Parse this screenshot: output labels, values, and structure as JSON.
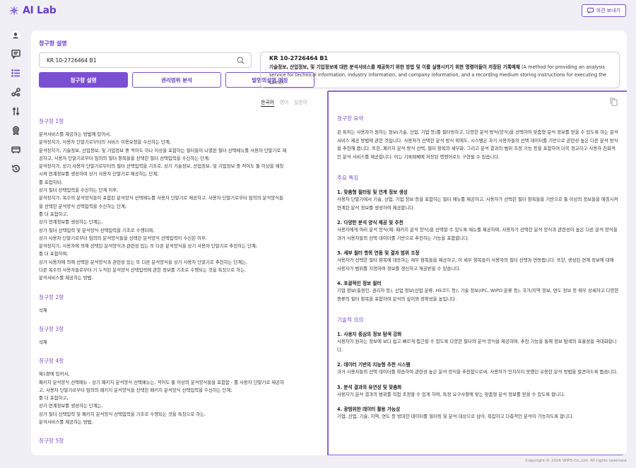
{
  "app": {
    "name": "AI Lab",
    "feedback_label": "의견 보내기",
    "footer": "Copyright © 2026 WIPS Co.,Ltd. All rights reserved."
  },
  "sidebar": {
    "icons": [
      "user-icon",
      "chat-icon",
      "list-icon",
      "network-icon",
      "swap-icon",
      "award-icon",
      "card-icon",
      "history-icon"
    ],
    "active": 2
  },
  "page": {
    "section_title": "청구항 설명",
    "search_value": "KR 10-2726464 B1"
  },
  "tabs": {
    "claim_desc": "청구항 설명",
    "rights_analysis": "권리범위 분석",
    "invention_mapping": "발명의설명 매핑"
  },
  "info": {
    "id": "KR 10-2726464 B1",
    "title_ko": "기술정보, 산업정보, 및 기업정보에 대한 분석서비스를 제공하기 위한 방법 및 이를 실행시키기 위한 명령어들이 저장된 기록매체",
    "title_en": " (A method for providing an analysis service for technical information, industry information, and company information, and a recording medium storing instructions for executing the same)"
  },
  "lang": {
    "ko": "한국어",
    "en": "영어",
    "ja": "일본어"
  },
  "claims": [
    {
      "title": "청구항 1항",
      "lines": [
        "분석서비스를 제공하는 방법에 있어서,",
        "분석장치가, 사용자 단말기로부터의 서비스 이용요청을 수신하는 단계;",
        "분석장치가, 기술정보, 산업정보, 및 기업정보 중 적어도 하나 이상을 포함하는 필터들이 나열된 필터 선택메뉴를 사용자 단말기로 제",
        "공하고, 사용자 단말기로부터 임의의 필터 항목들을 선택한 필터 선택입력을 수신하는 단계;",
        "분석장치가, 상기 사용자 단말기로부터의 필터 선택입력을 기초로, 상기 기술정보, 산업정보, 및 기업정보 중 적어도 둘 이상을 매칭",
        "시켜 연계정보를 생성하여 상기 사용자 단말기로 제공하는 단계;",
        "를 포함하되,",
        "상기 필터 선택입력을 수신하는 단계 이후,",
        "분석장치가, 복수의 분석양식들이 포함된 분석양식 선택메뉴를 사용자 단말기로 제공하고, 사용자 단말기로부터 임의의 분석양식들",
        "을 선택한 분석양식 선택입력을 수신하는 단계;",
        "를 더 포함하고,",
        "상기 연계정보를 생성하는 단계는,",
        "상기 필터 선택입력 및 분석양식 선택입력을 기초로 수행되며,",
        "상기 사용자 단말기로부터 임의의 분석양식들을 선택한 분석양식 선택입력이 수신된 이후,",
        "분석장치가, 사용자에 의해 선택된 분석양식과 관련성 있는 또 다른 분석양식을 상기 사용자 단말기로 추천하는 단계;",
        "를 더 포함하며,",
        "상기 사용자에 의해 선택된 분석양식과 관련성 있는 또 다른 분석양식을 상기 사용자 단말기로 추천하는 단계는,",
        "다른 복수의 사용자들로부터 기 누적된 분석양식 선택입력에 관한 정보를 기초로 수행되는 것을 특징으로 하는,",
        "분석서비스를 제공하는 방법."
      ]
    },
    {
      "title": "청구항 2항",
      "lines": [
        "삭제"
      ]
    },
    {
      "title": "청구항 3항",
      "lines": [
        "삭제"
      ]
    },
    {
      "title": "청구항 4항",
      "lines": [
        "제1항에 있어서,",
        "패키지 분석양식 선택메뉴 - 상기 패키지 분석양식 선택메뉴는, 적어도 둘 이상의 분석양식들을 포함함 - 를 사용자 단말기로 제공하",
        "고, 사용자 단말기로부터 임의의 패키지 분석양식을 선택한 패키지 분석양식 선택입력을 수신하는 단계;",
        "를 더 포함하고,",
        "상기 연계정보를 생성하는 단계는,",
        "상기 필터 선택입력 및 패키지 분석양식 선택입력을 기초로 수행되는 것을 특징으로 하는,",
        "분석서비스를 제공하는 방법."
      ]
    },
    {
      "title": "청구항 5항",
      "lines": []
    }
  ],
  "summary": {
    "h1": "청구항 요약",
    "p1": "본 특허는 사용자가 원하는 정보(기술, 산업, 기업 등)를 필터링하고, 다양한 분석 방식(양식)을 선택하여 맞춤형 분석 정보를 얻을 수 있도록 하는 분석 서비스 제공 방법에 관한 것입니다. 사용자가 선택한 분석 방식 외에도, 시스템은 과거 사용자들의 선택 데이터를 기반으로 관련성 높은 다른 분석 방식을 추천해 줍니다. 또한, 패키지 분석 방식 선택, 필터 항목의 세부화, 그리고 분석 결과의 범위 조정 기능 등을 포함하여 더욱 정교하고 사용자 친화적인 분석 서비스를 제공합니다. 이는 기록매체에 저장된 명령어로도 구현될 수 있습니다.",
    "h2": "주요 특징",
    "features": [
      {
        "title": "1. 맞춤형 필터링 및 연계 정보 생성",
        "text": "사용자 단말기에서 기술, 산업, 기업 정보 등을 포함하는 필터 메뉴를 제공하고, 사용자가 선택한 필터 항목들을 기반으로 둘 이상의 정보들을 매칭시켜 연계된 분석 정보를 생성하여 제공합니다."
      },
      {
        "title": "2. 다양한 분석 양식 제공 및 추천",
        "text": "사용자에게 여러 분석 양식(예: 패키지 분석 양식)을 선택할 수 있도록 메뉴를 제공하며, 사용자가 선택한 분석 양식과 관련성이 높은 다른 분석 양식을 과거 사용자들의 선택 데이터를 기반으로 추천하는 기능을 포함합니다."
      },
      {
        "title": "3. 세부 필터 항목 연동 및 결과 범위 조정",
        "text": "사용자가 선택한 필터 항목에 대응하는 세부 항목들을 제공하고, 이 세부 항목들이 사용자의 필터 선택과 연동됩니다. 또한, 생성된 연계 정보에 대해 사용자가 범위를 지정하여 정보를 갱신하고 재공받을 수 있습니다."
      },
      {
        "title": "4. 포괄적인 정보 필터",
        "text": "기업 정보(출원인, 권리자 등), 산업 정보(산업 분류, HS코드 등), 기술 정보(IPC, WIPO 분류 등), 국가/지역 정보, 연도 정보 등 매우 상세하고 다양한 종류의 필터 항목을 포함하여 분석의 깊이와 정확성을 높입니다."
      }
    ],
    "h3": "기술적 의의",
    "significance": [
      {
        "title": "1. 사용자 중심의 정보 탐색 강화",
        "text": "사용자가 원하는 정보에 보다 쉽고 빠르게 접근할 수 있도록 다양한 필터와 분석 양식을 제공하며, 추천 기능을 통해 정보 탐색의 효율성을 극대화합니다."
      },
      {
        "title": "2. 데이터 기반의 지능형 추천 시스템",
        "text": "과거 사용자들의 선택 데이터를 학습하여 관련성 높은 분석 양식을 추천함으로써, 사용자가 인지하지 못했던 유용한 분석 방법을 발견하도록 돕습니다."
      },
      {
        "title": "3. 분석 결과의 유연성 및 맞춤화",
        "text": "사용자가 분석 결과의 범위를 직접 조정할 수 있게 하여, 특정 요구사항에 맞는 맞춤형 분석 정보를 얻을 수 있도록 합니다."
      },
      {
        "title": "4. 광범위한 데이터 활용 가능성",
        "text": "기업, 산업, 기술, 지역, 연도 등 방대한 데이터를 필터링 및 분석 대상으로 삼아, 복잡하고 다층적인 분석이 가능하도록 합니다."
      }
    ]
  },
  "colors": {
    "accent": "#7b4fd3",
    "logo": "#6a3fc3"
  }
}
